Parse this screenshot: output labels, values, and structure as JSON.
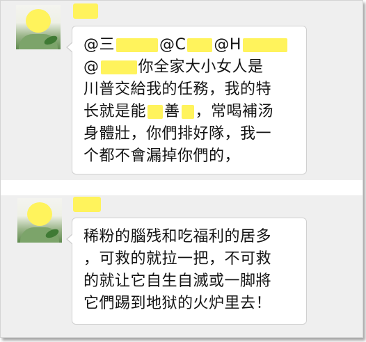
{
  "messages": [
    {
      "lines": {
        "l1_a": "@三",
        "l1_b": "@C",
        "l1_c": "@H",
        "l2_a": "@",
        "l2_b": "你全家大小女人是",
        "l3": "川普交給我的任務，我的特",
        "l4_a": "长就是能",
        "l4_b": "善",
        "l4_c": "，常喝補汤",
        "l5": "身體壯，你們排好隊，我一",
        "l6": "个都不會漏掉你們的，"
      }
    },
    {
      "lines": {
        "l1": "稀粉的腦残和吃福利的居多",
        "l2": "，可救的就拉一把，不可救",
        "l3": "的就让它自生自滅或一脚將",
        "l4": "它們踢到地狱的火炉里去！"
      }
    }
  ],
  "colors": {
    "redaction": "#fff35c",
    "background": "#efefef",
    "bubble": "#ffffff"
  }
}
